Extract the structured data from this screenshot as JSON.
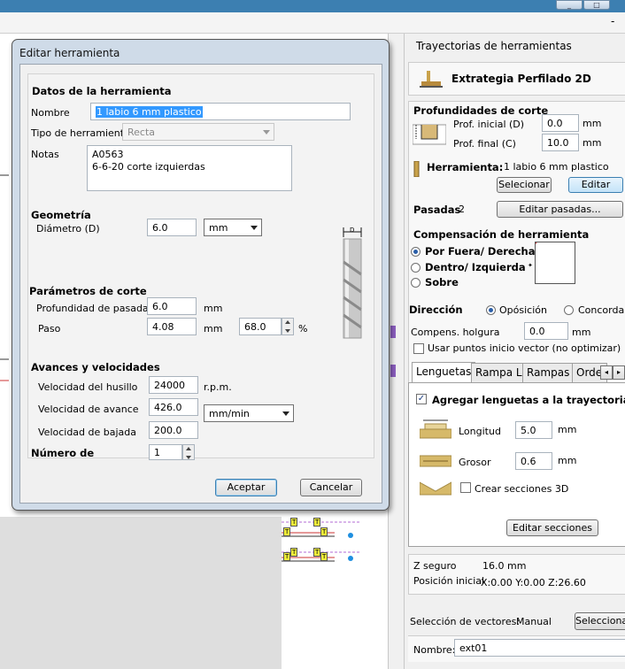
{
  "window": {
    "controls": [
      "_",
      "□",
      "×"
    ],
    "side_marker": "-"
  },
  "dialog": {
    "title": "Editar herramienta",
    "tool_data": {
      "heading": "Datos de la herramienta",
      "name_label": "Nombre",
      "name_value": "1 labio 6 mm plastico",
      "type_label": "Tipo de herramienta",
      "type_value": "Recta",
      "notes_label": "Notas",
      "notes_line1": "A0563",
      "notes_line2": "6-6-20 corte izquierdas"
    },
    "geometry": {
      "heading": "Geometría",
      "diameter_label": "Diámetro (D)",
      "diameter_value": "6.0",
      "unit": "mm",
      "tool_marker": "D"
    },
    "cut": {
      "heading": "Parámetros de corte",
      "depth_label": "Profundidad de pasada",
      "depth_value": "6.0",
      "depth_unit": "mm",
      "step_label": "Paso",
      "step_value": "4.08",
      "step_unit": "mm",
      "step_percent": "68.0",
      "percent_sign": "%"
    },
    "feeds": {
      "heading": "Avances y velocidades",
      "spindle_label": "Velocidad del husillo",
      "spindle_value": "24000",
      "spindle_unit": "r.p.m.",
      "feed_label": "Velocidad de avance",
      "feed_value": "426.0",
      "feed_unit": "mm/min",
      "plunge_label": "Velocidad de bajada",
      "plunge_value": "200.0"
    },
    "number": {
      "heading": "Número de",
      "value": "1"
    },
    "ok_label": "Aceptar",
    "cancel_label": "Cancelar"
  },
  "panel": {
    "header": "Trayectorias de herramientas",
    "strategy_title": "Extrategia Perfilado 2D",
    "depths": {
      "heading": "Profundidades de corte",
      "start_label": "Prof. inicial (D)",
      "start_value": "0.0",
      "end_label": "Prof. final (C)",
      "end_value": "10.0",
      "unit": "mm"
    },
    "tool": {
      "label": "Herramienta:",
      "value": "1 labio 6 mm plastico",
      "select_label": "Selecionar",
      "edit_label": "Editar"
    },
    "passes": {
      "label": "Pasadas",
      "value": "2",
      "edit_label": "Editar pasadas..."
    },
    "compensation": {
      "heading": "Compensación de herramienta",
      "options": [
        "Por Fuera/ Derecha",
        "Dentro/ Izquierda",
        "Sobre"
      ],
      "selected": 0
    },
    "direction": {
      "label": "Dirección",
      "opt1": "Opósición",
      "opt2": "Concordancia"
    },
    "clearance": {
      "label": "Compens. holgura",
      "value": "0.0",
      "unit": "mm"
    },
    "vector_start": "Usar puntos inicio vector (no optimizar)",
    "tabs": [
      "Lenguetas",
      "Rampa L.",
      "Rampas",
      "Orde"
    ],
    "tab_nav": [
      "◂",
      "▸"
    ],
    "tabs_panel": {
      "add_label": "Agregar lenguetas a la trayectoria",
      "length_label": "Longitud",
      "length_value": "5.0",
      "thickness_label": "Grosor",
      "thickness_value": "0.6",
      "unit": "mm",
      "sections3d_label": "Crear secciones 3D",
      "edit_sections_label": "Editar secciones"
    },
    "info": {
      "z_safe_label": "Z seguro",
      "z_safe_value": "16.0 mm",
      "home_label": "Posición inicial",
      "home_value": "X:0.00 Y:0.00 Z:26.60"
    },
    "vector_selection": {
      "label": "Selección de vectores:",
      "value": "Manual",
      "button": "Seleccionar"
    },
    "name": {
      "label": "Nombre:",
      "value": "ext01"
    }
  },
  "canvas": {
    "tab_marker": "T"
  },
  "colors": {
    "accent": "#3c7fb1",
    "selection": "#3399ff",
    "tab_yellow": "#f2ef3a",
    "dashed": "#b36bd6"
  }
}
